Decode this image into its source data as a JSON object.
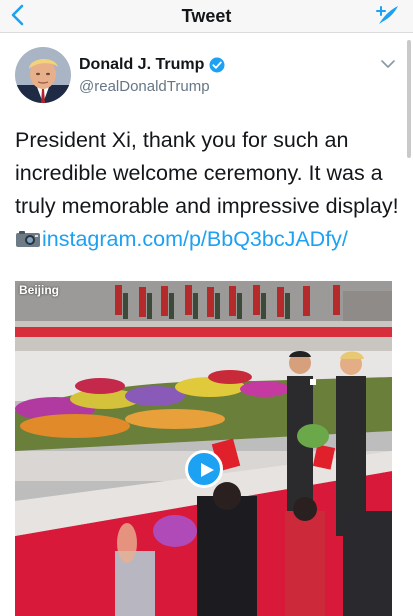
{
  "nav": {
    "title": "Tweet"
  },
  "tweet": {
    "display_name": "Donald J. Trump",
    "handle": "@realDonaldTrump",
    "text_lines": [
      "President Xi, thank you for such an",
      "incredible welcome ceremony. It was a",
      "truly memorable and impressive display!"
    ],
    "link": "instagram.com/p/BbQ3bcJADfy/"
  },
  "media": {
    "location_label": "Beijing"
  },
  "colors": {
    "accent": "#1da1f2",
    "text": "#14171a",
    "secondary_text": "#657786",
    "nav_background": "#f7f7f7"
  },
  "icons": {
    "back": "chevron-left-icon",
    "compose": "compose-tweet-icon",
    "verified": "verified-badge-icon",
    "more": "chevron-down-icon",
    "camera": "camera-emoji-icon",
    "play": "play-icon"
  }
}
